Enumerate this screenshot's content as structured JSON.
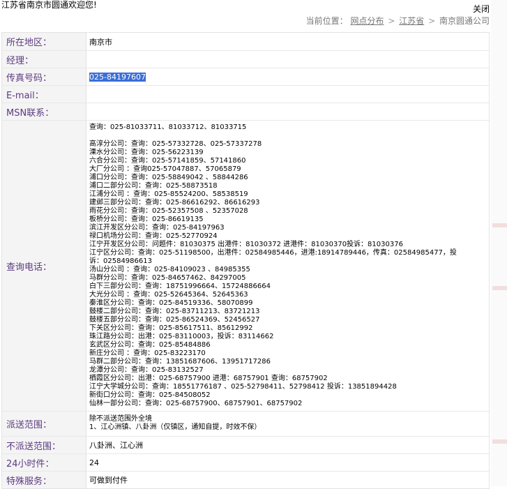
{
  "welcome": "江苏省南京市圆通欢迎您!",
  "close_label": "关闭",
  "breadcrumb": {
    "prefix": "当前位置：",
    "items": [
      "网点分布",
      "江苏省",
      "南京圆通公司"
    ],
    "sep": ">"
  },
  "fields": {
    "area": {
      "label": "所在地区：",
      "value": "南京市"
    },
    "manager": {
      "label": "经理：",
      "value": ""
    },
    "fax": {
      "label": "传真号码：",
      "value": "025-84197607"
    },
    "email": {
      "label": "E-mail：",
      "value": ""
    },
    "msn": {
      "label": "MSN联系：",
      "value": ""
    },
    "inquiry": {
      "label": "查询电话：",
      "first": "查询：025-81033711、81033712、81033715",
      "lines": [
        "高淳分公司：查询：025-57332728、025-57337278",
        "溧水分公司：查询：025-56223139",
        "六合分公司：查询：025-57141859、57141860",
        "大厂分公司 ：查询025-57047887、57065879",
        "浦口分公司：查询：025-58849042 、58844286",
        "浦口二部分公司：查询：025-58873518",
        "江浦分公司 ：查询：025-85524200、58538519",
        "建邺三部分公司：查询：025-86616292、86616293",
        "雨花分公司：查询：025-52357508 、52357028",
        "板桥分公司：查询：025-86619135",
        "滨江开发区分公司：查询：025-84197963",
        "禄口机场分公司：查询：025-52770924",
        "江宁开发区分公司：问题件：81030375  出港件：81030372   进港件：81030370投诉：81030376",
        "江宁区分公司：查询：025-51198500，出港件：02584985446，进港:18914789446，传真：02584985477，投",
        "诉：02584986613",
        "汤山分公司 ：查询：025-84109023 、84985355",
        "马群分公司：查询：025-84657462、84297005",
        "白下三部分公司：查询：18751996664、15724886664",
        "大光分公司 ：查询：025-52645364、52645363",
        "秦淮区分公司：查询：025-84519336、58070899",
        "鼓楼二部分公司：查询：025-83711213、83721213",
        "鼓楼五部分公司：查询：025-86524369、52456527",
        "下关区分公司：查询：025-85617511、85612992",
        "珠江路分公司：出港：025-83110003，投诉：83114662",
        "玄武区分公司：查询：025-85484886",
        "新庄分公司 ：查询：025-83223170",
        "马群二部分公司：查询：13851687606、13951717286",
        "龙潭分公司：查询：025-83132527",
        "栖霞区分公司：出港：025-68757900   进港：68757901    查询：68757902",
        "江宁大学城分公司：查询：18551776187 、025-52798411、52798412 投诉：13851894428",
        "新街口分公司：查询：025-84508052",
        "仙林一部分公司：查询：025-68757900、68757901、68757902"
      ]
    },
    "delivery": {
      "label": "派送范围：",
      "line1": "除不派送范围外全境",
      "line2": "1、江心洲镇、八卦洲（仅镇区，通知自提，时效不保）"
    },
    "nodelivery": {
      "label": "不派送范围：",
      "value": "八卦洲、江心洲"
    },
    "h24": {
      "label": "24小时件：",
      "value": "24"
    },
    "special": {
      "label": "特殊服务：",
      "value": "可做到付件"
    }
  }
}
